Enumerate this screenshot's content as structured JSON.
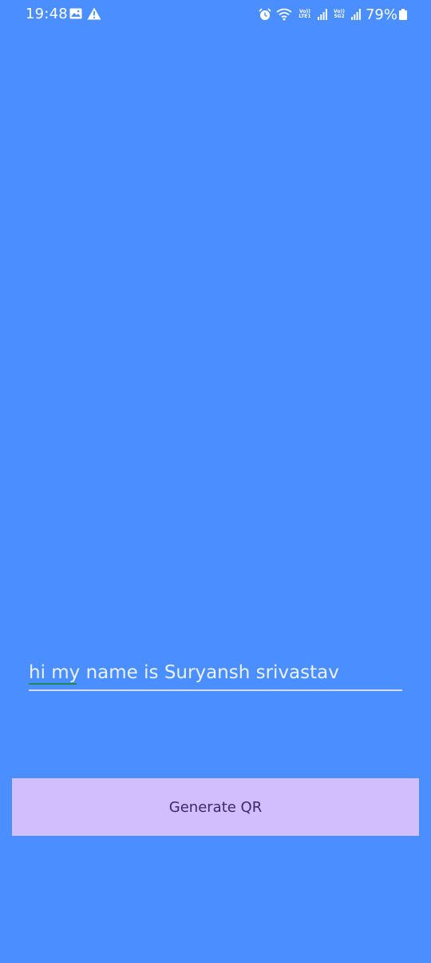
{
  "status_bar": {
    "time": "19:48",
    "network_1": "Vo)) LTE1",
    "network_2": "Vo)) 5G2",
    "battery_percent": "79%",
    "icons": [
      "gallery-icon",
      "warning-icon",
      "alarm-icon",
      "wifi-icon",
      "signal-icon",
      "signal-icon",
      "battery-icon"
    ]
  },
  "input": {
    "value": "hi my name is Suryansh srivastav"
  },
  "generate_button": {
    "label": "Generate QR"
  },
  "colors": {
    "background": "#4A8FFD",
    "button": "#D2BDFD",
    "button_text": "#3A2A66",
    "field_underline": "#D3DBEF"
  }
}
